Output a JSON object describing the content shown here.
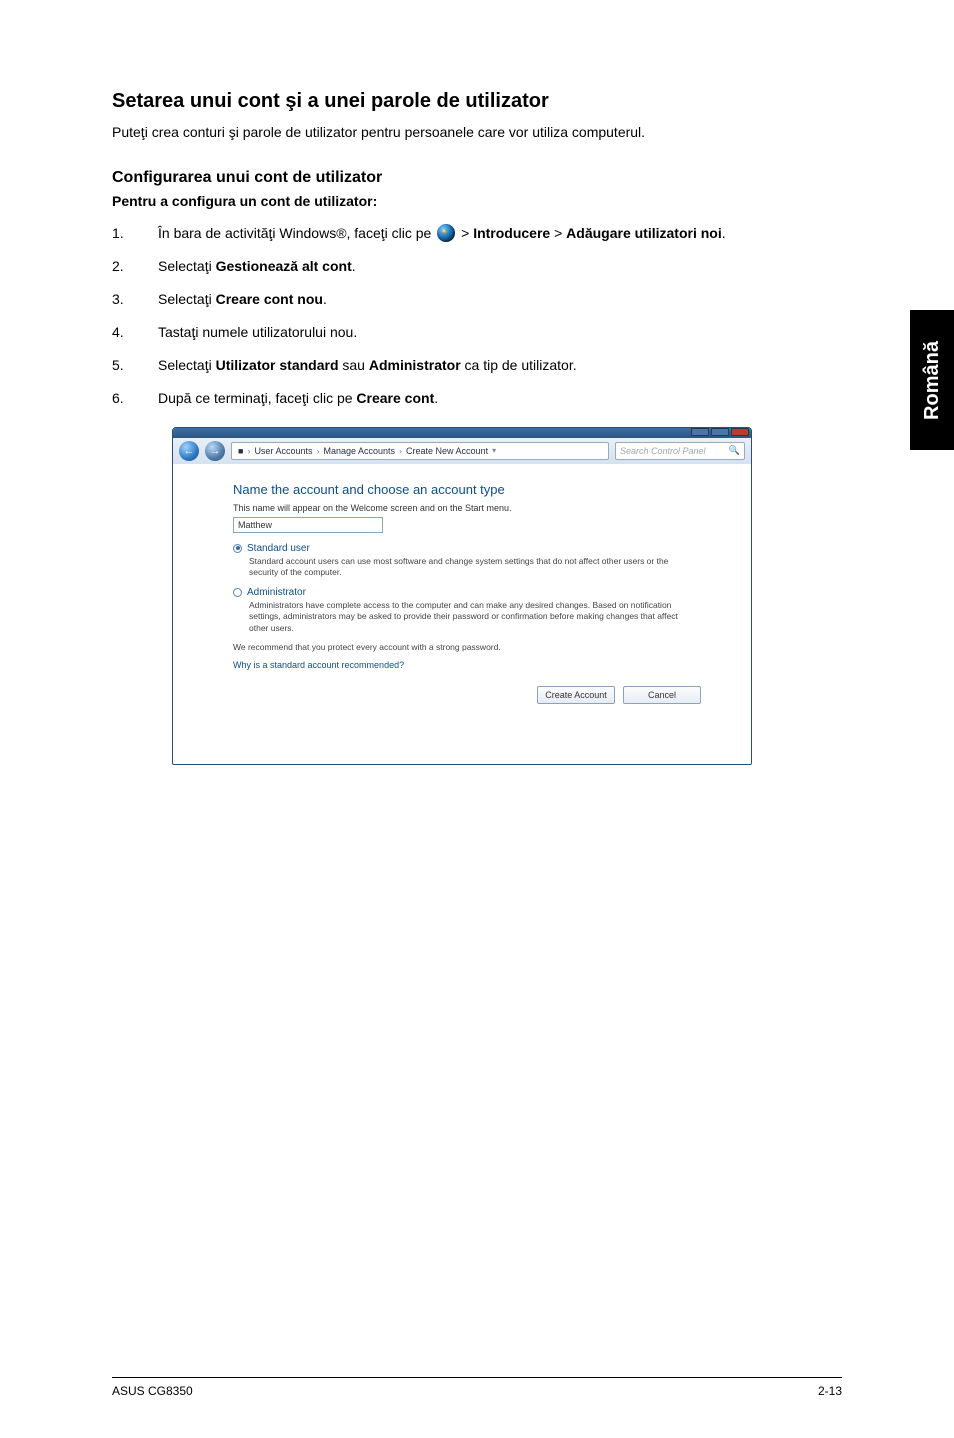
{
  "sideTab": "Română",
  "section": {
    "title": "Setarea unui cont şi a unei parole de utilizator",
    "intro": "Puteţi crea conturi şi parole de utilizator pentru persoanele care vor utiliza computerul."
  },
  "config": {
    "heading": "Configurarea unui cont de utilizator",
    "subheading": "Pentru a configura un cont de utilizator:"
  },
  "steps": {
    "s1": {
      "num": "1.",
      "pre": "În bara de activităţi Windows®, faceţi clic pe ",
      "post1": " > ",
      "b1": "Introducere",
      "post2": " > ",
      "b2": "Adăugare utilizatori noi",
      "tail": "."
    },
    "s2": {
      "num": "2.",
      "pre": "Selectaţi ",
      "b": "Gestionează alt cont",
      "tail": "."
    },
    "s3": {
      "num": "3.",
      "pre": "Selectaţi ",
      "b": "Creare cont nou",
      "tail": "."
    },
    "s4": {
      "num": "4.",
      "txt": "Tastaţi numele utilizatorului nou."
    },
    "s5": {
      "num": "5.",
      "pre": "Selectaţi ",
      "b1": "Utilizator standard",
      "mid": " sau ",
      "b2": "Administrator",
      "tail": " ca tip de utilizator."
    },
    "s6": {
      "num": "6.",
      "pre": "După ce terminaţi, faceţi clic pe ",
      "b": "Creare cont",
      "tail": "."
    }
  },
  "win": {
    "crumb": {
      "c1": "User Accounts",
      "c2": "Manage Accounts",
      "c3": "Create New Account"
    },
    "search_placeholder": "Search Control Panel",
    "heading": "Name the account and choose an account type",
    "sub": "This name will appear on the Welcome screen and on the Start menu.",
    "name_value": "Matthew",
    "opt1": {
      "label": "Standard user",
      "desc": "Standard account users can use most software and change system settings that do not affect other users or the security of the computer."
    },
    "opt2": {
      "label": "Administrator",
      "desc": "Administrators have complete access to the computer and can make any desired changes. Based on notification settings, administrators may be asked to provide their password or confirmation before making changes that affect other users."
    },
    "reco": "We recommend that you protect every account with a strong password.",
    "link": "Why is a standard account recommended?",
    "btn_create": "Create Account",
    "btn_cancel": "Cancel"
  },
  "footer": {
    "left": "ASUS CG8350",
    "right": "2-13"
  }
}
